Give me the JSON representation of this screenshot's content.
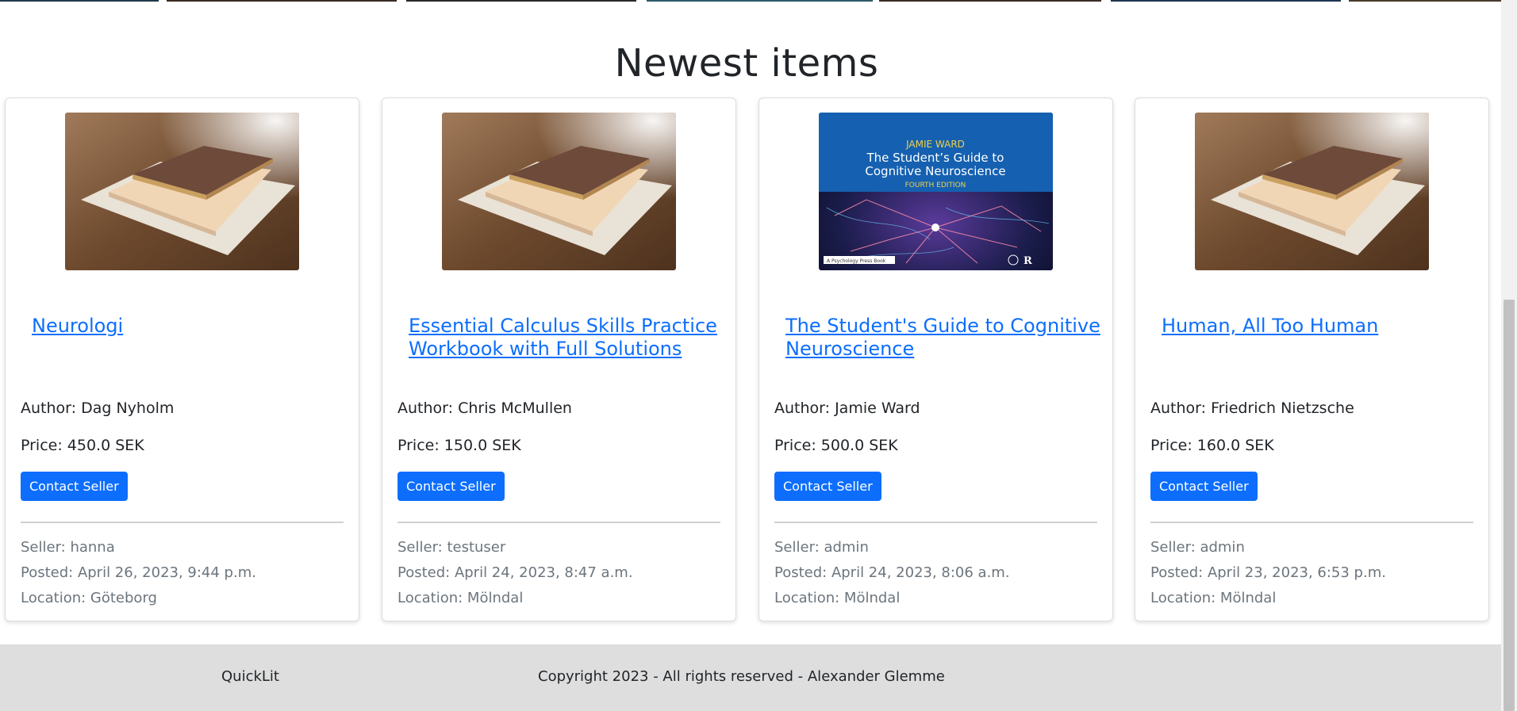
{
  "section": {
    "title": "Newest items"
  },
  "items": [
    {
      "title": "Neurologi",
      "author": "Author: Dag Nyholm",
      "price": "Price: 450.0 SEK",
      "contact_label": "Contact Seller",
      "seller": "Seller: hanna",
      "posted": "Posted: April 26, 2023, 9:44 p.m.",
      "location": "Location: Göteborg",
      "image": "book-on-table-photo"
    },
    {
      "title": "Essential Calculus Skills Practice Workbook with Full Solutions",
      "author": "Author: Chris McMullen",
      "price": "Price: 150.0 SEK",
      "contact_label": "Contact Seller",
      "seller": "Seller: testuser",
      "posted": "Posted: April 24, 2023, 8:47 a.m.",
      "location": "Location: Mölndal",
      "image": "book-on-table-photo"
    },
    {
      "title": "The Student's Guide to Cognitive Neuroscience",
      "author": "Author: Jamie Ward",
      "price": "Price: 500.0 SEK",
      "contact_label": "Contact Seller",
      "seller": "Seller: admin",
      "posted": "Posted: April 24, 2023, 8:06 a.m.",
      "location": "Location: Mölndal",
      "image": "book-cover",
      "cover": {
        "author": "JAMIE WARD",
        "title_line1": "The Student’s Guide to",
        "title_line2": "Cognitive Neuroscience",
        "edition": "FOURTH EDITION",
        "publisher": "A Psychology Press Book"
      }
    },
    {
      "title": "Human, All Too Human",
      "author": "Author: Friedrich Nietzsche",
      "price": "Price: 160.0 SEK",
      "contact_label": "Contact Seller",
      "seller": "Seller: admin",
      "posted": "Posted: April 23, 2023, 6:53 p.m.",
      "location": "Location: Mölndal",
      "image": "book-on-table-photo"
    }
  ],
  "footer": {
    "brand": "QuickLit",
    "copyright": "Copyright 2023 - All rights reserved - Alexander Glemme"
  },
  "colors": {
    "link": "#0d6efd",
    "button": "#0d6efd",
    "footer_bg": "#dedede",
    "muted_text": "#6c757d"
  }
}
